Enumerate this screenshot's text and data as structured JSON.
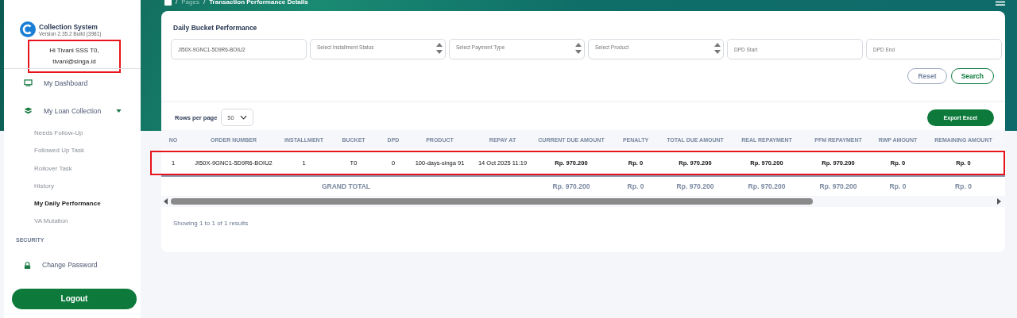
{
  "breadcrumb": {
    "separator_1": "/",
    "parent": "Pages",
    "separator_2": "/",
    "current": "Transaction Performance Details"
  },
  "sidebar": {
    "app_name": "Collection System",
    "version": "Version 2.35.2 Build (3981)",
    "greeting": {
      "lines": [
        "Hi Tivani SSS T0,",
        "tivani@singa.id"
      ],
      "highlighted": true
    },
    "menu": [
      {
        "label": "My Dashboard",
        "kind": "link"
      },
      {
        "label": "My Loan Collection",
        "kind": "group",
        "expanded": true,
        "children": [
          {
            "label": "Needs Follow-Up",
            "selected": false
          },
          {
            "label": "Followed Up Task",
            "selected": false
          },
          {
            "label": "Rollover Task",
            "selected": false
          },
          {
            "label": "History",
            "selected": false
          },
          {
            "label": "My Daily Performance",
            "selected": true
          },
          {
            "label": "VA Mutation",
            "selected": false
          }
        ]
      }
    ],
    "section_label": "SECURITY",
    "security_menu": [
      {
        "label": "Change Password"
      }
    ],
    "logout": "Logout"
  },
  "card": {
    "title": "Daily Bucket Performance",
    "filters": [
      {
        "kind": "text",
        "value": "JI50X-9GNC1-5D9R6-BOIU2"
      },
      {
        "kind": "select",
        "placeholder": "Select Installment Status"
      },
      {
        "kind": "select",
        "placeholder": "Select Payment Type"
      },
      {
        "kind": "select",
        "placeholder": "Select Product"
      },
      {
        "kind": "text",
        "placeholder": "DPD Start"
      },
      {
        "kind": "text",
        "placeholder": "DPD End"
      }
    ],
    "buttons": [
      "Reset",
      "Search"
    ]
  },
  "table_section": {
    "rows_per_page_label": "Rows per page",
    "rows_per_page": "50",
    "export": "Export Excel",
    "columns": [
      "NO",
      "ORDER NUMBER",
      "INSTALLMENT",
      "BUCKET",
      "DPD",
      "PRODUCT",
      "REPAY AT",
      "CURRENT DUE AMOUNT",
      "PENALTY",
      "TOTAL DUE AMOUNT",
      "REAL REPAYMENT",
      "PFM REPAYMENT",
      "RWP AMOUNT",
      "REMAINING AMOUNT"
    ],
    "rows": [
      {
        "highlighted": true,
        "cells": [
          "1",
          "JI50X-9GNC1-5D9R6-BOIU2",
          "1",
          "T0",
          "0",
          "100-days-singa 91",
          "14 Oct 2025 11:19",
          "Rp. 970.200",
          "Rp. 0",
          "Rp. 970.200",
          "Rp. 970.200",
          "Rp. 970.200",
          "Rp. 0",
          "Rp. 0"
        ]
      }
    ],
    "grand_total": {
      "label": "GRAND TOTAL",
      "values": [
        "Rp. 970.200",
        "Rp. 0",
        "Rp. 970.200",
        "Rp. 970.200",
        "Rp. 970.200",
        "Rp. 0",
        "Rp. 0"
      ]
    },
    "summary": "Showing 1 to 1 of 1 results"
  }
}
